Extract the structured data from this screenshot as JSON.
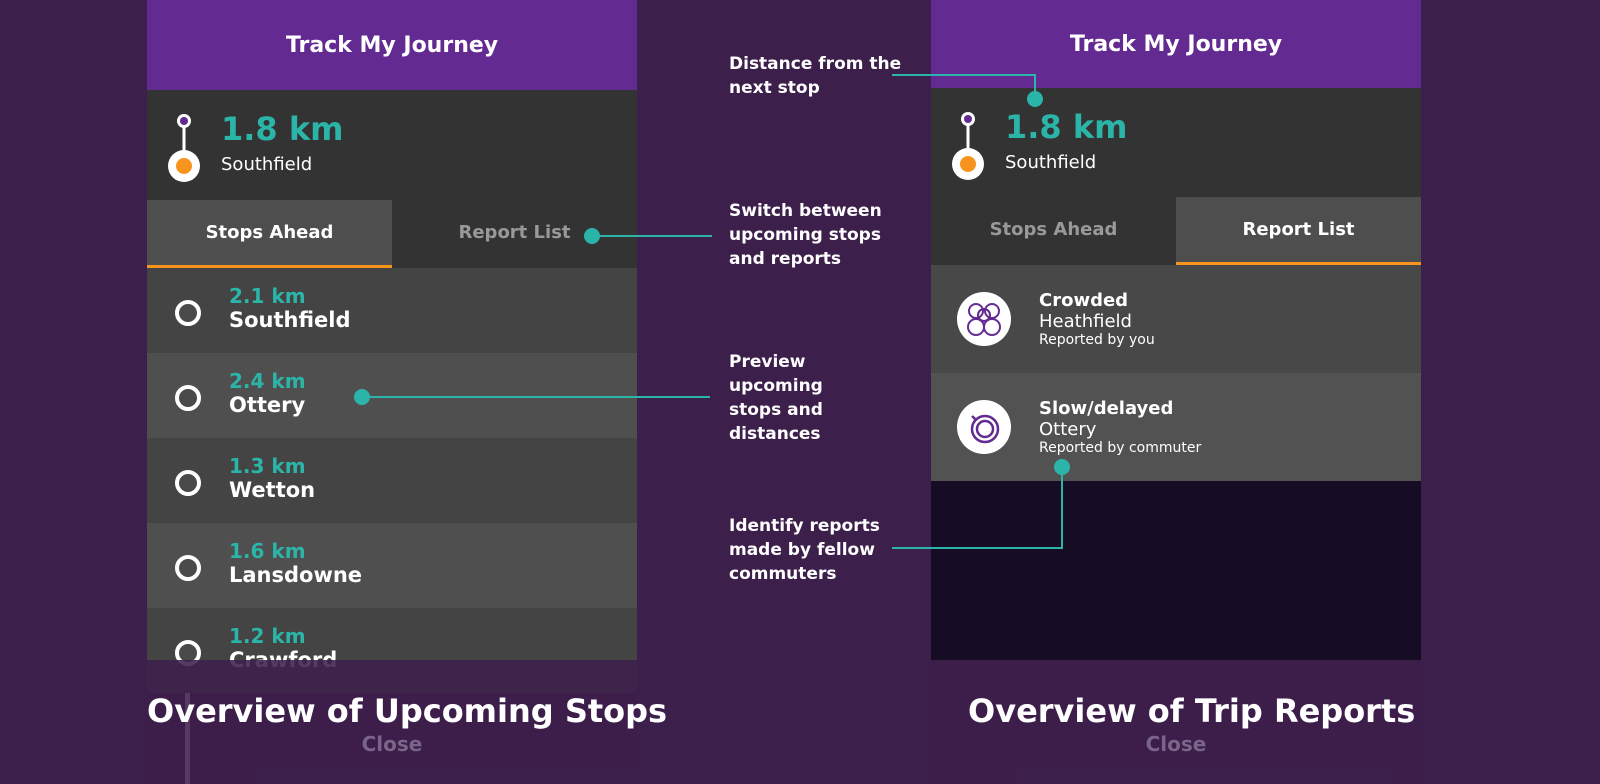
{
  "app_title": "Track My Journey",
  "current": {
    "distance": "1.8 km",
    "stop": "Southfield"
  },
  "tabs": [
    "Stops Ahead",
    "Report List"
  ],
  "stops": [
    {
      "km": "2.1 km",
      "name": "Southfield"
    },
    {
      "km": "2.4 km",
      "name": "Ottery"
    },
    {
      "km": "1.3 km",
      "name": "Wetton"
    },
    {
      "km": "1.6 km",
      "name": "Lansdowne"
    },
    {
      "km": "1.2 km",
      "name": "Crawford"
    }
  ],
  "reports": [
    {
      "type": "Crowded",
      "stop": "Heathfield",
      "by": "Reported by you",
      "icon": "crowd-icon"
    },
    {
      "type": "Slow/delayed",
      "stop": "Ottery",
      "by": "Reported by commuter",
      "icon": "stopwatch-icon"
    }
  ],
  "close_label": "Close",
  "captions": [
    "Overview of Upcoming Stops",
    "Overview of Trip Reports"
  ],
  "annotations": [
    "Distance from the next stop",
    "Switch between upcoming stops and reports",
    "Preview upcoming stops and distances",
    "Identify reports made by fellow commuters"
  ],
  "colors": {
    "background": "#3d1f4b",
    "header": "#632b91",
    "accent": "#2bb5a8",
    "tab_indicator": "#f7941d"
  }
}
